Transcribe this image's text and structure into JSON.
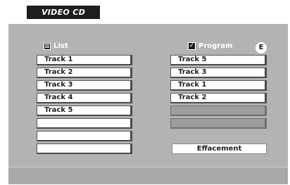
{
  "header": {
    "title": "VIDEO CD"
  },
  "list": {
    "label": "List",
    "icon": "list-icon",
    "rows": [
      "Track 1",
      "Track 2",
      "Track 3",
      "Track 4",
      "Track 5",
      "",
      "",
      ""
    ]
  },
  "program": {
    "label": "Program",
    "icon": "checkbox-checked-icon",
    "checked": true,
    "badge": "E",
    "rows": [
      "Track 5",
      "Track 3",
      "Track 1",
      "Track 2",
      "",
      ""
    ]
  },
  "actions": {
    "clear_label": "Effacement"
  },
  "colors": {
    "panel": "#b3b3b3",
    "title_bg": "#1e1e1e",
    "row_bg": "#ffffff",
    "empty_program_row": "#9d9d9d"
  }
}
